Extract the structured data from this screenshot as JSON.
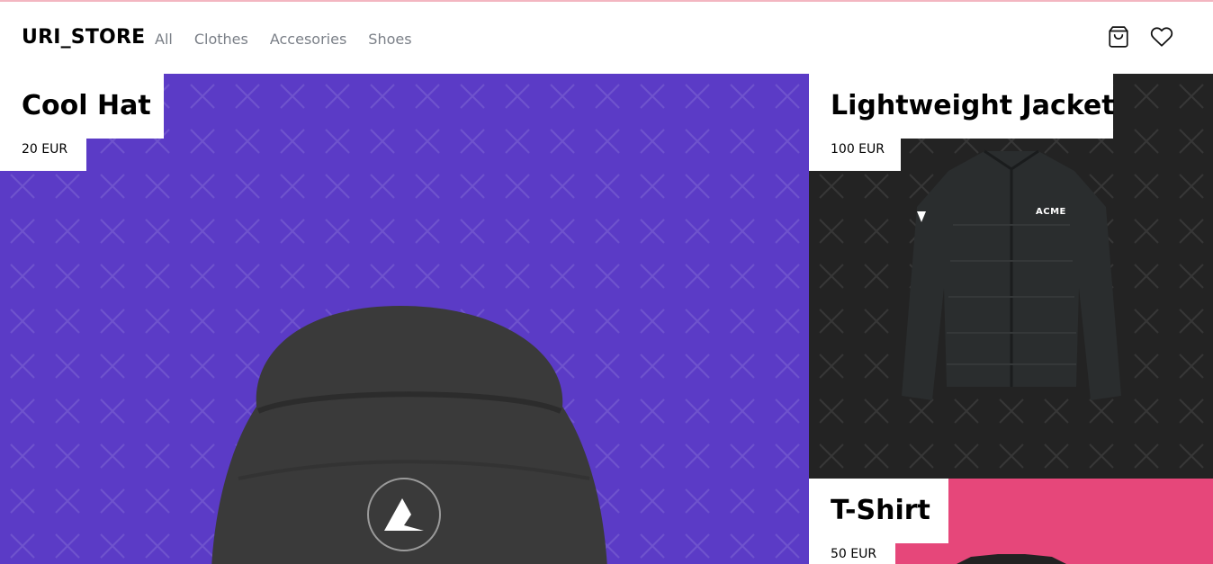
{
  "header": {
    "logo": "URI_STORE",
    "nav": [
      {
        "label": "All"
      },
      {
        "label": "Clothes"
      },
      {
        "label": "Accesories"
      },
      {
        "label": "Shoes"
      }
    ],
    "icons": [
      "shopping-bag-icon",
      "heart-icon"
    ]
  },
  "products": [
    {
      "title": "Cool Hat",
      "price": "20 EUR",
      "background": "#5b3bc6",
      "image": "beanie-hat-image"
    },
    {
      "title": "Lightweight Jacket",
      "price": "100 EUR",
      "background": "#232323",
      "image": "jacket-image",
      "brand_text": "ACME"
    },
    {
      "title": "T-Shirt",
      "price": "50 EUR",
      "background": "#e6477a",
      "image": "tshirt-image"
    }
  ],
  "colors": {
    "nav_text": "#7a7f87",
    "top_line": "#f3b6c1",
    "label_bg": "#ffffff"
  }
}
